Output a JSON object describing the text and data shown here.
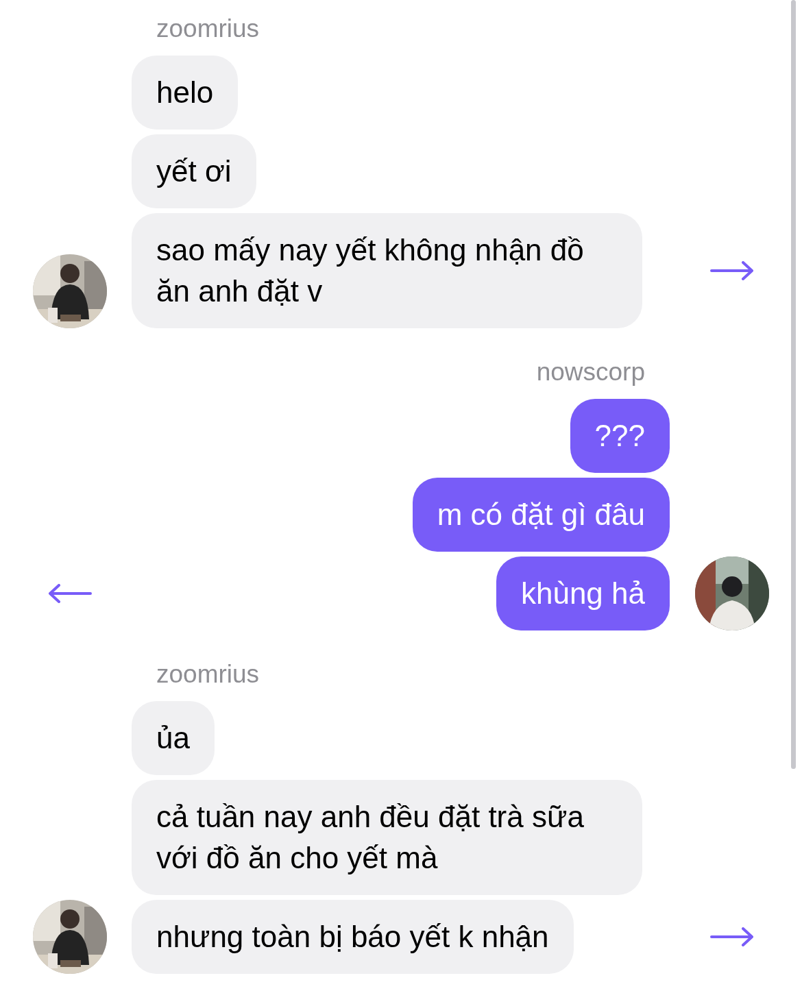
{
  "groups": [
    {
      "sender": "zoomrius",
      "kind": "incoming",
      "messages": [
        "helo",
        "yết ơi",
        "sao mấy nay yết không nhận đồ ăn anh đặt v"
      ]
    },
    {
      "sender": "nowscorp",
      "kind": "outgoing",
      "messages": [
        "???",
        "m có đặt gì đâu",
        "khùng hả"
      ]
    },
    {
      "sender": "zoomrius",
      "kind": "incoming",
      "messages": [
        "ủa",
        "cả tuần nay anh đều đặt trà sữa với đồ ăn cho yết mà",
        "nhưng toàn bị báo yết k nhận"
      ]
    }
  ]
}
